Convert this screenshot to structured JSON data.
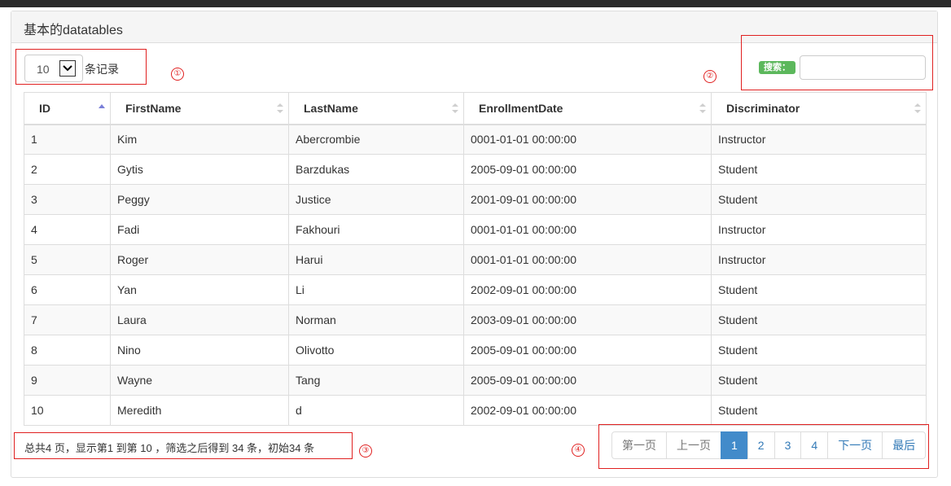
{
  "panel": {
    "title": "基本的datatables"
  },
  "length": {
    "value": "10",
    "label": "条记录"
  },
  "search": {
    "label": "搜索：",
    "value": ""
  },
  "annotations": [
    "①",
    "②",
    "③",
    "④"
  ],
  "table": {
    "columns": [
      "ID",
      "FirstName",
      "LastName",
      "EnrollmentDate",
      "Discriminator"
    ],
    "sorted_column": "ID",
    "sorted_direction": "ascending",
    "rows": [
      [
        "1",
        "Kim",
        "Abercrombie",
        "0001-01-01 00:00:00",
        "Instructor"
      ],
      [
        "2",
        "Gytis",
        "Barzdukas",
        "2005-09-01 00:00:00",
        "Student"
      ],
      [
        "3",
        "Peggy",
        "Justice",
        "2001-09-01 00:00:00",
        "Student"
      ],
      [
        "4",
        "Fadi",
        "Fakhouri",
        "0001-01-01 00:00:00",
        "Instructor"
      ],
      [
        "5",
        "Roger",
        "Harui",
        "0001-01-01 00:00:00",
        "Instructor"
      ],
      [
        "6",
        "Yan",
        "Li",
        "2002-09-01 00:00:00",
        "Student"
      ],
      [
        "7",
        "Laura",
        "Norman",
        "2003-09-01 00:00:00",
        "Student"
      ],
      [
        "8",
        "Nino",
        "Olivotto",
        "2005-09-01 00:00:00",
        "Student"
      ],
      [
        "9",
        "Wayne",
        "Tang",
        "2005-09-01 00:00:00",
        "Student"
      ],
      [
        "10",
        "Meredith",
        "d",
        "2002-09-01 00:00:00",
        "Student"
      ]
    ]
  },
  "info": {
    "text": "总共4 页，显示第1 到第 10 ，筛选之后得到 34 条，初始34 条"
  },
  "pagination": {
    "first": "第一页",
    "prev": "上一页",
    "pages": [
      "1",
      "2",
      "3",
      "4"
    ],
    "active": "1",
    "next": "下一页",
    "last": "最后"
  },
  "colors": {
    "annotation_red": "#e02020",
    "search_badge": "#5cb85c",
    "active_page": "#428bca",
    "link": "#337ab7"
  }
}
